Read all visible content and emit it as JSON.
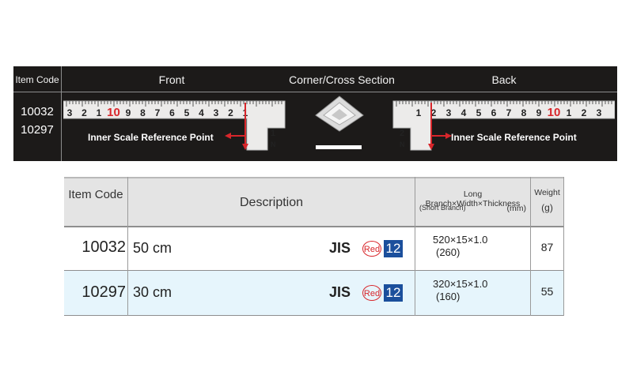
{
  "panel": {
    "headers": {
      "item_code": "Item Code",
      "front": "Front",
      "corner": "Corner/Cross Section",
      "back": "Back"
    },
    "codes": [
      "10032",
      "10297"
    ],
    "front_scale_digits": [
      "3",
      "2",
      "1",
      "10",
      "9",
      "8",
      "7",
      "6",
      "5",
      "4",
      "3",
      "2",
      "1"
    ],
    "back_scale_digits": [
      "1",
      "2",
      "3",
      "4",
      "5",
      "6",
      "7",
      "8",
      "9",
      "10",
      "1",
      "2",
      "3"
    ],
    "inner_scale_label": "Inner Scale Reference Point"
  },
  "table": {
    "headers": {
      "item_code": "Item Code",
      "description": "Description",
      "dims": "Long Branch×Width×Thickness",
      "dims_sub": "(Short Branch)",
      "dims_unit": "(mm)",
      "weight": "Weight",
      "weight_unit": "(g)"
    },
    "rows": [
      {
        "code": "10032",
        "desc": "50 cm",
        "jis": "JIS",
        "color": "Red",
        "grade": "12",
        "dims": "520×15×1.0",
        "dims_short": "(260)",
        "weight": "87"
      },
      {
        "code": "10297",
        "desc": "30 cm",
        "jis": "JIS",
        "color": "Red",
        "grade": "12",
        "dims": "320×15×1.0",
        "dims_short": "(160)",
        "weight": "55"
      }
    ]
  },
  "colors": {
    "panel_bg": "#1c1a19",
    "red": "#d8262b",
    "blue_badge": "#1b4f9c",
    "row_highlight": "#e6f5fc"
  }
}
